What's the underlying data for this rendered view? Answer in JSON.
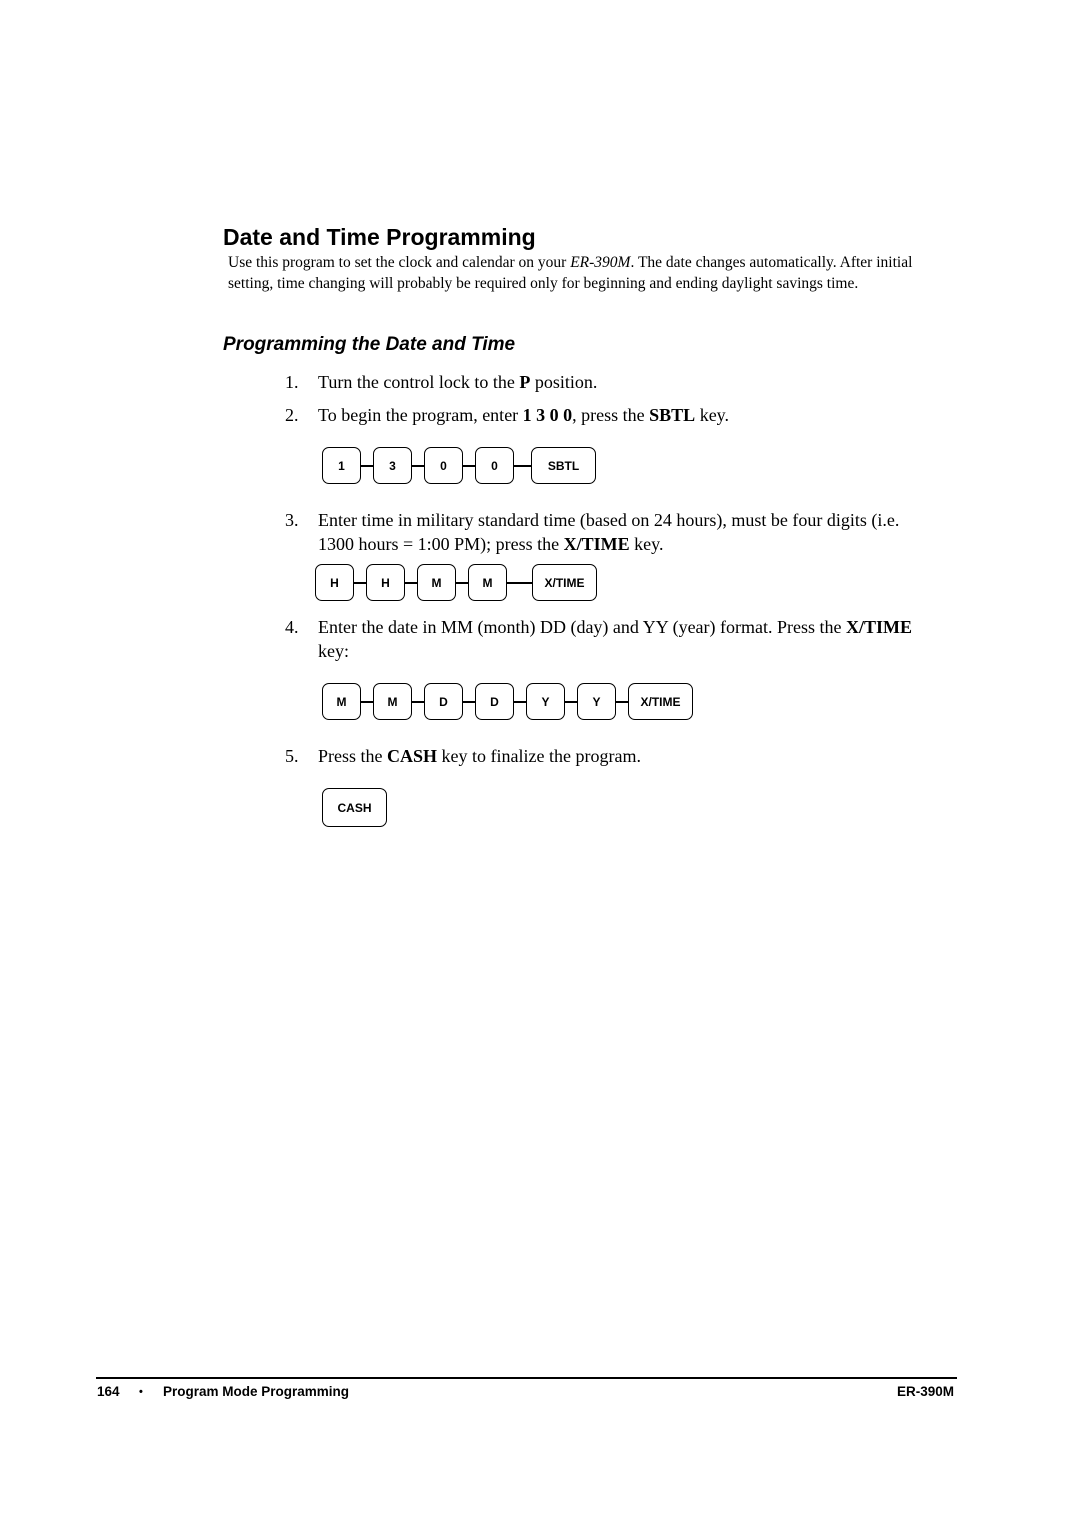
{
  "page": {
    "title": "Date and Time Programming",
    "intro": {
      "before_italic": "Use this program to set the clock and calendar on your ",
      "italic": "ER-390M",
      "after_italic": ". The date changes automatically. After initial setting, time changing will probably be required only for beginning and ending daylight savings time."
    },
    "subtitle": "Programming the Date and Time",
    "steps": [
      {
        "num": "1.",
        "parts": [
          {
            "t": "Turn the control lock to the "
          },
          {
            "b": "P"
          },
          {
            "t": " position."
          }
        ]
      },
      {
        "num": "2.",
        "parts": [
          {
            "t": "To begin the program, enter "
          },
          {
            "b": "1 3 0 0"
          },
          {
            "t": ", press the "
          },
          {
            "b": "SBTL"
          },
          {
            "t": " key."
          }
        ],
        "keys": [
          "1",
          "3",
          "0",
          "0",
          "SBTL"
        ]
      },
      {
        "num": "3.",
        "parts": [
          {
            "t": "Enter time in military standard time (based on 24 hours), must be four digits (i.e. 1300 hours = 1:00 PM); press the "
          },
          {
            "b": "X/TIME"
          },
          {
            "t": " key."
          }
        ],
        "keys": [
          "H",
          "H",
          "M",
          "M",
          "X/TIME"
        ]
      },
      {
        "num": "4.",
        "parts": [
          {
            "t": "Enter the date in MM (month) DD (day) and YY (year) format. Press the "
          },
          {
            "b": "X/TIME"
          },
          {
            "t": " key:"
          }
        ],
        "keys": [
          "M",
          "M",
          "D",
          "D",
          "Y",
          "Y",
          "X/TIME"
        ]
      },
      {
        "num": "5.",
        "parts": [
          {
            "t": "Press the "
          },
          {
            "b": "CASH"
          },
          {
            "t": " key to finalize the program."
          }
        ],
        "keys": [
          "CASH"
        ]
      }
    ],
    "footer": {
      "page_number": "164",
      "bullet": "•",
      "section": "Program Mode Programming",
      "model": "ER-390M"
    }
  }
}
